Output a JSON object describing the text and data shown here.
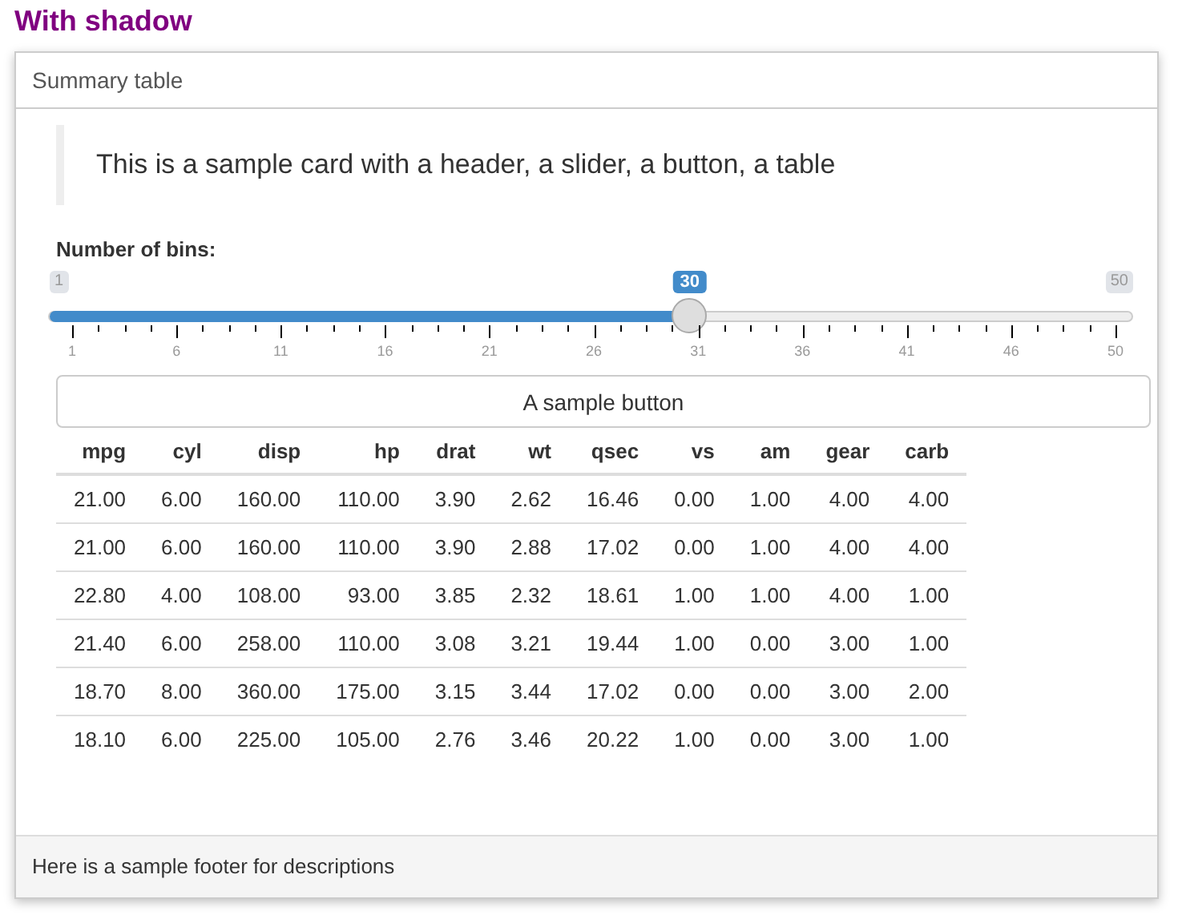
{
  "heading": "With shadow",
  "card": {
    "header": "Summary table",
    "quote": "This is a sample card with a header, a slider, a button, a table",
    "slider": {
      "label": "Number of bins:",
      "min": "1",
      "max": "50",
      "value": "30",
      "level": 0.592,
      "grid_labels": [
        "1",
        "6",
        "11",
        "16",
        "21",
        "26",
        "31",
        "36",
        "41",
        "46",
        "50"
      ]
    },
    "button": "A sample button",
    "table": {
      "columns": [
        "mpg",
        "cyl",
        "disp",
        "hp",
        "drat",
        "wt",
        "qsec",
        "vs",
        "am",
        "gear",
        "carb"
      ],
      "rows": [
        [
          "21.00",
          "6.00",
          "160.00",
          "110.00",
          "3.90",
          "2.62",
          "16.46",
          "0.00",
          "1.00",
          "4.00",
          "4.00"
        ],
        [
          "21.00",
          "6.00",
          "160.00",
          "110.00",
          "3.90",
          "2.88",
          "17.02",
          "0.00",
          "1.00",
          "4.00",
          "4.00"
        ],
        [
          "22.80",
          "4.00",
          "108.00",
          "93.00",
          "3.85",
          "2.32",
          "18.61",
          "1.00",
          "1.00",
          "4.00",
          "1.00"
        ],
        [
          "21.40",
          "6.00",
          "258.00",
          "110.00",
          "3.08",
          "3.21",
          "19.44",
          "1.00",
          "0.00",
          "3.00",
          "1.00"
        ],
        [
          "18.70",
          "8.00",
          "360.00",
          "175.00",
          "3.15",
          "3.44",
          "17.02",
          "0.00",
          "0.00",
          "3.00",
          "2.00"
        ],
        [
          "18.10",
          "6.00",
          "225.00",
          "105.00",
          "2.76",
          "3.46",
          "20.22",
          "1.00",
          "0.00",
          "3.00",
          "1.00"
        ]
      ]
    },
    "footer": "Here is a sample footer for descriptions"
  }
}
